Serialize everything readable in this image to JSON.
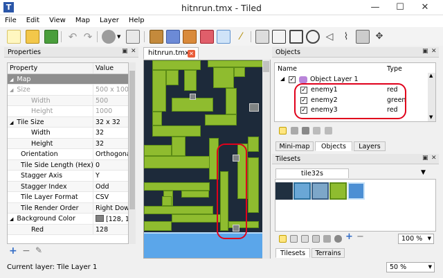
{
  "window": {
    "title": "hitnrun.tmx - Tiled",
    "minimize": "—",
    "maximize": "☐",
    "close": "✕"
  },
  "menu": [
    "File",
    "Edit",
    "View",
    "Map",
    "Layer",
    "Help"
  ],
  "toolbar": {
    "icons": [
      "new-file",
      "open",
      "save",
      "undo",
      "redo",
      "command",
      "dice",
      "stamp",
      "terrain-brush",
      "bucket-fill",
      "eraser",
      "rectangle-select",
      "magic-wand",
      "insert-rectangle",
      "insert-polygon",
      "insert-polyline",
      "insert-ellipse",
      "insert-tile",
      "edit-polygon",
      "move"
    ]
  },
  "properties": {
    "title": "Properties",
    "col_property": "Property",
    "col_value": "Value",
    "rows": [
      {
        "k": "Map",
        "v": "",
        "type": "group",
        "expander": "◢"
      },
      {
        "k": "Size",
        "v": "500 x 1000",
        "type": "gray",
        "expander": "◢"
      },
      {
        "k": "Width",
        "v": "500",
        "type": "gray-sub"
      },
      {
        "k": "Height",
        "v": "1000",
        "type": "gray-sub"
      },
      {
        "k": "Tile Size",
        "v": "32 x 32",
        "type": "normal",
        "expander": "◢"
      },
      {
        "k": "Width",
        "v": "32",
        "type": "sub"
      },
      {
        "k": "Height",
        "v": "32",
        "type": "sub"
      },
      {
        "k": "Orientation",
        "v": "Orthogonal",
        "type": "normal"
      },
      {
        "k": "Tile Side Length (Hex)",
        "v": "0",
        "type": "normal"
      },
      {
        "k": "Stagger Axis",
        "v": "Y",
        "type": "normal"
      },
      {
        "k": "Stagger Index",
        "v": "Odd",
        "type": "normal"
      },
      {
        "k": "Tile Layer Format",
        "v": "CSV",
        "type": "normal"
      },
      {
        "k": "Tile Render Order",
        "v": "Right Down",
        "type": "normal"
      },
      {
        "k": "Background Color",
        "v": "[128, 12",
        "type": "normal",
        "expander": "◢",
        "swatch": "#808080"
      },
      {
        "k": "Red",
        "v": "128",
        "type": "sub"
      }
    ],
    "footer": [
      "+",
      "−",
      "✎"
    ]
  },
  "doc_tab": {
    "label": "hitnrun.tmx",
    "close": "✕"
  },
  "objects": {
    "title": "Objects",
    "col_name": "Name",
    "col_type": "Type",
    "layer": "Object Layer 1",
    "items": [
      {
        "name": "enemy1",
        "type": "red"
      },
      {
        "name": "enemy2",
        "type": "green"
      },
      {
        "name": "enemy3",
        "type": "red"
      }
    ],
    "tabs": [
      "Mini-map",
      "Objects",
      "Layers"
    ]
  },
  "tilesets": {
    "title": "Tilesets",
    "tab": "tile32s",
    "zoom": "100 %",
    "tabs": [
      "Tilesets",
      "Terrains"
    ]
  },
  "status": {
    "current_layer": "Current layer: Tile Layer 1",
    "zoom": "50 %"
  },
  "colors": {
    "accent": "#e0001b",
    "grass": "#8fbc2f",
    "water": "#5ba6ea",
    "dark": "#1d2a3a"
  }
}
